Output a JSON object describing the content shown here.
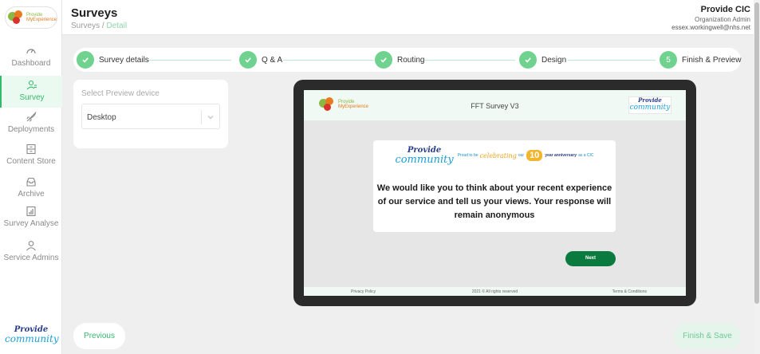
{
  "sidebar": {
    "logo_line1": "Provide",
    "logo_line2": "MyExperience",
    "items": [
      {
        "label": "Dashboard",
        "icon": "gauge-icon"
      },
      {
        "label": "Survey",
        "icon": "user-list-icon",
        "active": true
      },
      {
        "label": "Deployments",
        "icon": "rocket-icon"
      },
      {
        "label": "Content Store",
        "icon": "store-icon"
      },
      {
        "label": "Archive",
        "icon": "archive-icon"
      },
      {
        "label": "Survey Analyse",
        "icon": "chart-icon"
      },
      {
        "label": "Service Admins",
        "icon": "user-icon"
      }
    ],
    "bottom_logo_line1": "Provide",
    "bottom_logo_line2": "community"
  },
  "header": {
    "title": "Surveys",
    "breadcrumb_root": "Surveys",
    "breadcrumb_sep": "/",
    "breadcrumb_current": "Detail",
    "org_name": "Provide CIC",
    "org_role": "Organization Admin",
    "org_email": "essex.workingwell@nhs.net"
  },
  "stepper": {
    "steps": [
      {
        "label": "Survey details",
        "state": "done"
      },
      {
        "label": "Q & A",
        "state": "done"
      },
      {
        "label": "Routing",
        "state": "done"
      },
      {
        "label": "Design",
        "state": "done"
      },
      {
        "label": "Finish & Preview",
        "number": "5",
        "state": "current"
      }
    ]
  },
  "device": {
    "label": "Select Preview device",
    "value": "Desktop"
  },
  "preview": {
    "logo_line1": "Provide",
    "logo_line2": "MyExperience",
    "survey_name": "FFT Survey V3",
    "right_logo_line1": "Provide",
    "right_logo_line2": "community",
    "banner": {
      "logo_line1": "Provide",
      "logo_line2": "community",
      "proud": "Proud to be",
      "celebrating": "celebrating",
      "our": "our",
      "ten": "10",
      "anniversary": "year anniversary",
      "as_cic": "as a CIC"
    },
    "question": "We would like you to think about your recent experience of our service and tell us your views. Your response will remain anonymous",
    "next_label": "Next",
    "footer_left": "Privacy Policy",
    "footer_mid": "2021 © All rights reserved",
    "footer_right": "Terms & Conditions"
  },
  "actions": {
    "previous_label": "Previous",
    "finish_label": "Finish & Save"
  },
  "colors": {
    "accent": "#35b86b",
    "step_done": "#6fd28e",
    "next_button": "#0b7a3e",
    "brand_blue": "#2a3f8a",
    "brand_cyan": "#1a9fd6"
  }
}
